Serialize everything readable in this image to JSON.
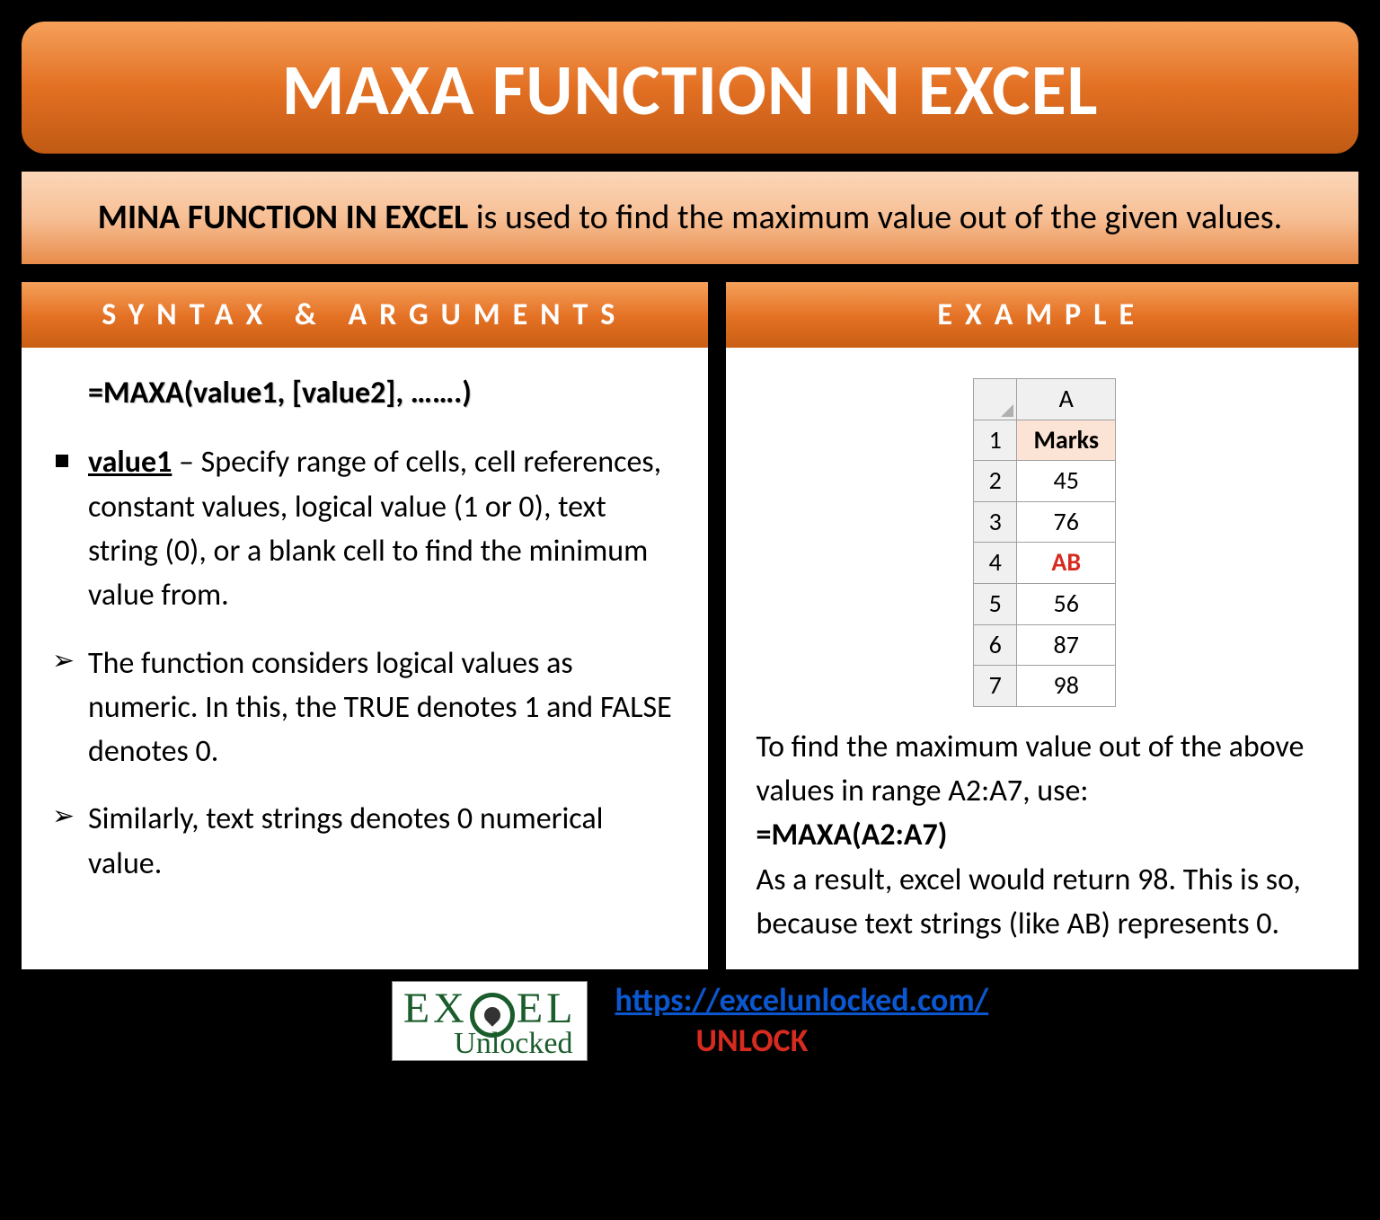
{
  "title": "MAXA FUNCTION IN EXCEL",
  "subtitle": {
    "strong": "MINA FUNCTION IN EXCEL",
    "rest": " is used to find the maximum value out of the given values."
  },
  "left": {
    "header": "SYNTAX & ARGUMENTS",
    "syntax": "=MAXA(value1, [value2], …….)",
    "value_label": "value1",
    "value_desc": " – Specify range of cells, cell references, constant values, logical value (1 or 0), text string (0), or a blank cell to find the minimum value from.",
    "note1": "The function considers logical values as numeric. In this, the TRUE denotes 1 and FALSE denotes 0.",
    "note2": "Similarly, text strings denotes 0 numerical value."
  },
  "right": {
    "header": "EXAMPLE",
    "table": {
      "col": "A",
      "rows": [
        "1",
        "2",
        "3",
        "4",
        "5",
        "6",
        "7"
      ],
      "cells": [
        "Marks",
        "45",
        "76",
        "AB",
        "56",
        "87",
        "98"
      ]
    },
    "text1": "To find the maximum value out of the above values in range A2:A7, use:",
    "formula": "=MAXA(A2:A7)",
    "text2": "As a result, excel would return 98. This is so, because text strings (like AB) represents 0."
  },
  "footer": {
    "logo_top_left": "EX",
    "logo_top_right": "EL",
    "logo_bottom": "Unlocked",
    "url": "https://excelunlocked.com/",
    "unlock": "UNLOCK"
  }
}
